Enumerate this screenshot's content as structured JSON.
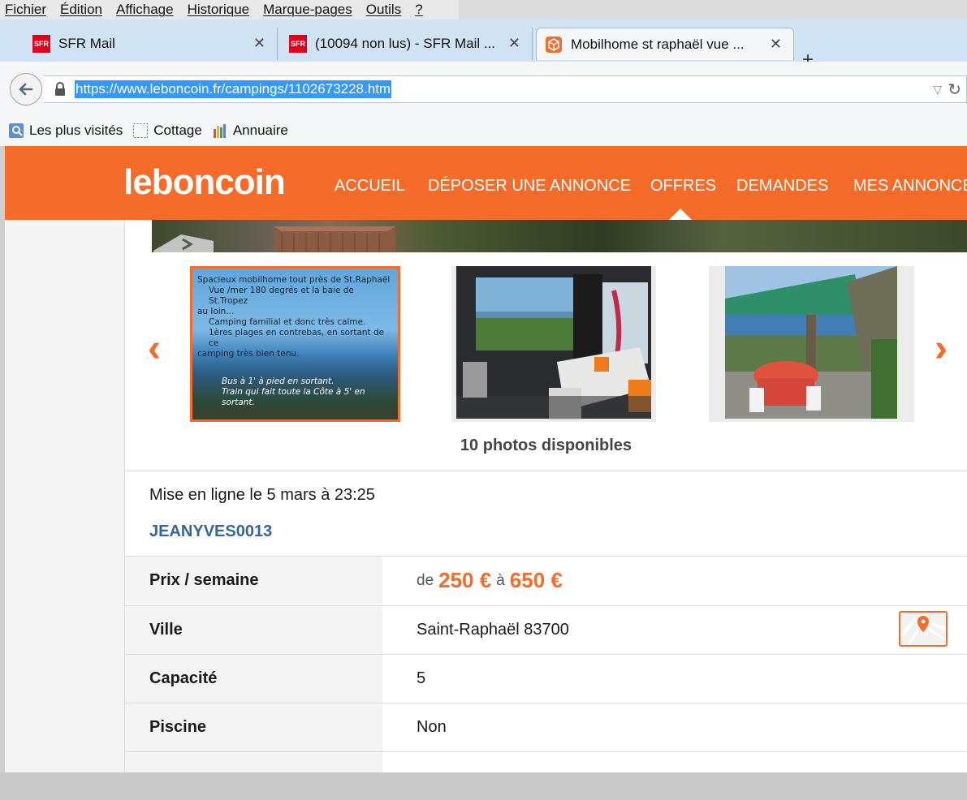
{
  "menubar": {
    "items": [
      "Fichier",
      "Édition",
      "Affichage",
      "Historique",
      "Marque-pages",
      "Outils",
      "?"
    ]
  },
  "tabs": [
    {
      "label": "SFR Mail",
      "icon": "sfr-icon",
      "active": false
    },
    {
      "label": "(10094 non lus) - SFR Mail ...",
      "icon": "sfr-icon",
      "active": false
    },
    {
      "label": "Mobilhome st raphaël vue ...",
      "icon": "leboncoin-icon",
      "active": true
    }
  ],
  "address_bar": {
    "url": "https://www.leboncoin.fr/campings/1102673228.htm"
  },
  "bookmarks": [
    {
      "label": "Les plus visités",
      "icon": "most-visited-icon"
    },
    {
      "label": "Cottage",
      "icon": "folder-icon"
    },
    {
      "label": "Annuaire",
      "icon": "directory-icon"
    }
  ],
  "site": {
    "logo": "leboncoin",
    "brand_color": "#f56b2a",
    "nav": [
      "ACCUEIL",
      "DÉPOSER UNE ANNONCE",
      "OFFRES",
      "DEMANDES",
      "MES ANNONCES"
    ],
    "active_nav": "OFFRES"
  },
  "gallery": {
    "thumb1_caption": [
      "Spacieux mobilhome tout près de St.Raphaël",
      "Vue /mer 180 degrés et la baie de St.Tropez",
      "au loin...",
      "Camping familial et donc très calme.",
      "1ères plages en contrebas, en sortant de ce",
      "camping très bien tenu."
    ],
    "thumb1_caption_bottom": [
      "Bus à 1' à pied en sortant.",
      "Train qui fait toute la Côte à 5' en sortant."
    ],
    "photos_count": "10 photos disponibles"
  },
  "listing": {
    "posted": "Mise en ligne le 5 mars à 23:25",
    "seller": "JEANYVES0013",
    "rows": [
      {
        "key": "Prix / semaine",
        "from_label": "de",
        "from": "250 €",
        "to_label": "à",
        "to": "650 €"
      },
      {
        "key": "Ville",
        "value": "Saint-Raphaël 83700"
      },
      {
        "key": "Capacité",
        "value": "5"
      },
      {
        "key": "Piscine",
        "value": "Non"
      }
    ]
  }
}
